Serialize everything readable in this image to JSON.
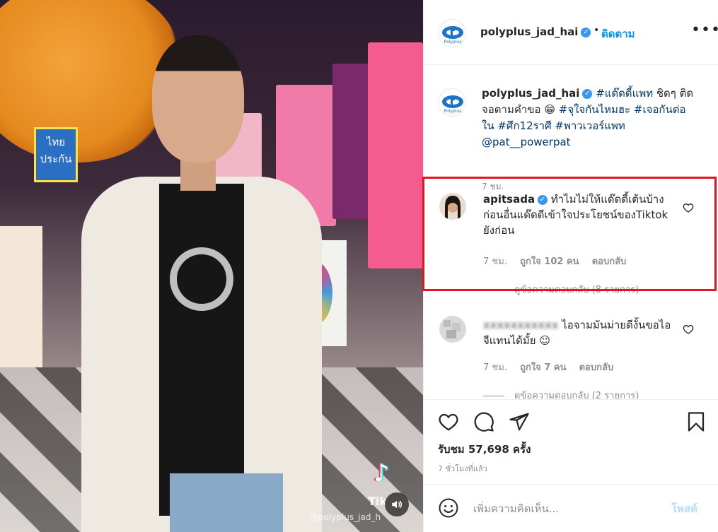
{
  "video": {
    "sign_text": "ไทย ประกัน",
    "tiktok_logo": "♪",
    "tiktok_text": "Tik",
    "tiktok_handle": "@polyplus_jad_h",
    "sound_icon": "speaker-icon"
  },
  "header": {
    "username": "polyplus_jad_hai",
    "verified": "✓",
    "dot": "•",
    "follow_label": "ติดตาม",
    "more_label": "•••"
  },
  "caption": {
    "username": "polyplus_jad_hai",
    "verified": "✓",
    "tag_1": "#แด๊ดดี้แพท",
    "text_1": " ชิดๆ ติดจอตามคำขอ 😁 ",
    "tag_2": "#จุใจกันไหมฮะ",
    "text_2": " ",
    "tag_3": "#เจอกันต่อใน",
    "text_3": " ",
    "tag_4": "#ศึก12ราศี",
    "text_4": " ",
    "tag_5": "#พาวเวอร์แพท",
    "mention": "@pat__powerpat",
    "time": "7 ชม."
  },
  "comment_1": {
    "username": "apitsada",
    "verified": "✓",
    "text": " ทำไมไม่ให้แด๊ดดี้เต้นบ้าง ก่อนอื่นแด๊ดดีเข้าใจประโยชน์ของTiktok ยังก่อน",
    "time": "7 ชม.",
    "likes": "ถูกใจ 102 คน",
    "reply": "ตอบกลับ",
    "view_replies": "ดูข้อความตอบกลับ (8 รายการ)"
  },
  "comment_2": {
    "username": "xxxxxxxxxxx",
    "text": " ไอจามมันม่ายดีงั้นขอไอจีแทนได้มั้ย ☺",
    "time": "7 ชม.",
    "likes": "ถูกใจ 7 คน",
    "reply": "ตอบกลับ",
    "view_replies": "ดูข้อความตอบกลับ (2 รายการ)"
  },
  "actions": {
    "views": "รับชม 57,698 ครั้ง",
    "ago": "7 ชั่วโมงที่แล้ว"
  },
  "add_comment": {
    "placeholder": "เพิ่มความคิดเห็น...",
    "post_label": "โพสต์"
  },
  "colors": {
    "link_blue": "#0095f6",
    "hashtag": "#00376b",
    "highlight_border": "#e3161b"
  }
}
